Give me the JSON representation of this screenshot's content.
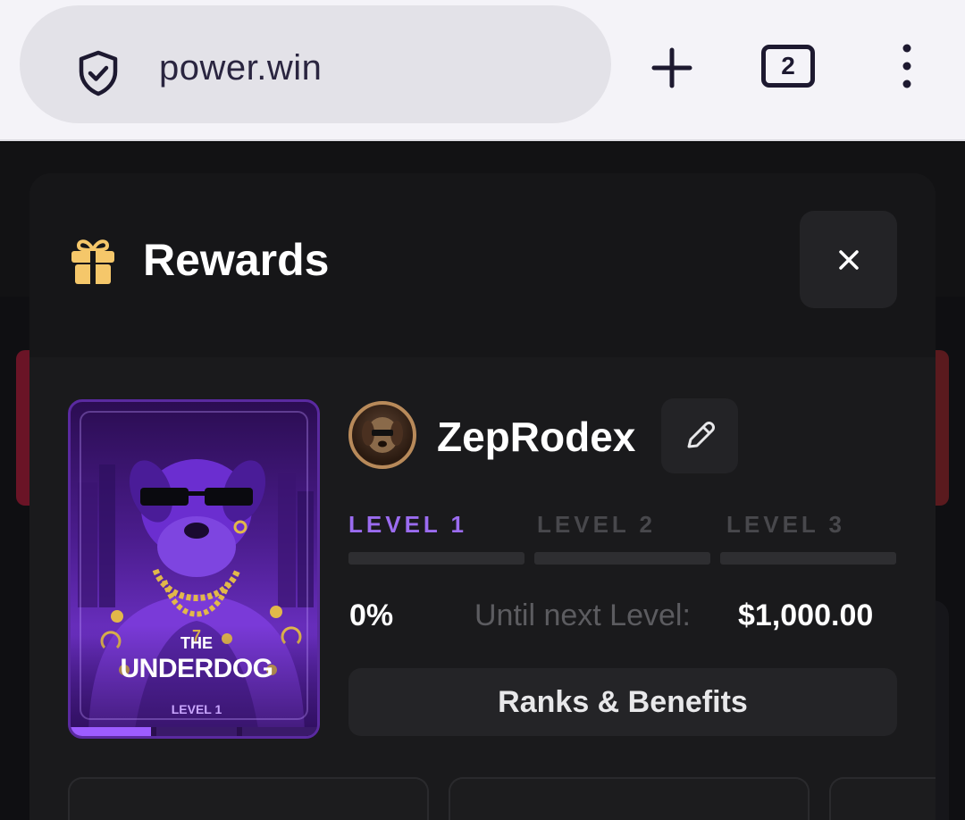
{
  "browser": {
    "url": "power.win",
    "tab_count": "2"
  },
  "modal": {
    "title": "Rewards",
    "close_label": "×"
  },
  "card": {
    "title_small": "THE",
    "title_large": "UNDERDOG",
    "level": "LEVEL 1"
  },
  "profile": {
    "username": "ZepRodex"
  },
  "levels": [
    {
      "label": "LEVEL 1",
      "active": true
    },
    {
      "label": "LEVEL 2",
      "active": false
    },
    {
      "label": "LEVEL 3",
      "active": false
    }
  ],
  "progress": {
    "percent_text": "0%",
    "percent_value": 0,
    "until_label": "Until next Level:",
    "until_value": "$1,000.00"
  },
  "buttons": {
    "ranks_benefits": "Ranks & Benefits"
  },
  "colors": {
    "accent_purple": "#9b6cf0",
    "gift_gold": "#f5c76a",
    "modal_bg": "#1a1a1c"
  },
  "icons": {
    "security": "shield-check-icon",
    "new_tab": "plus-icon",
    "menu": "more-vertical-icon",
    "gift": "gift-icon",
    "close": "close-icon",
    "edit": "pencil-icon"
  }
}
